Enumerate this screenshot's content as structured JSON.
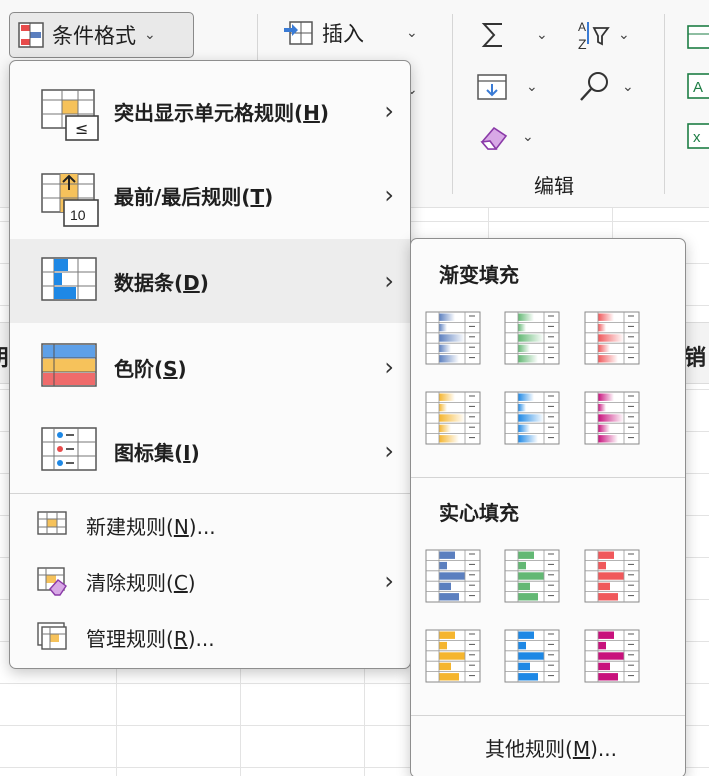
{
  "ribbon": {
    "conditional_format_label": "条件格式",
    "insert_label": "插入",
    "edit_group_label": "编辑"
  },
  "sheet": {
    "left_col_fragment": "刖",
    "right_col_fragment": "销"
  },
  "menu": {
    "items": [
      {
        "label_prefix": "突出显示单元格规则(",
        "mnemonic": "H",
        "label_suffix": ")",
        "icon": "highlight-cells-rules-icon"
      },
      {
        "label_prefix": "最前/最后规则(",
        "mnemonic": "T",
        "label_suffix": ")",
        "icon": "top-bottom-rules-icon"
      },
      {
        "label_prefix": "数据条(",
        "mnemonic": "D",
        "label_suffix": ")",
        "icon": "data-bars-icon"
      },
      {
        "label_prefix": "色阶(",
        "mnemonic": "S",
        "label_suffix": ")",
        "icon": "color-scales-icon"
      },
      {
        "label_prefix": "图标集(",
        "mnemonic": "I",
        "label_suffix": ")",
        "icon": "icon-sets-icon"
      }
    ],
    "small_items": [
      {
        "label_prefix": "新建规则(",
        "mnemonic": "N",
        "label_suffix": ")...",
        "icon": "new-rule-icon"
      },
      {
        "label_prefix": "清除规则(",
        "mnemonic": "C",
        "label_suffix": ")",
        "icon": "clear-rules-icon"
      },
      {
        "label_prefix": "管理规则(",
        "mnemonic": "R",
        "label_suffix": ")...",
        "icon": "manage-rules-icon"
      }
    ]
  },
  "submenu": {
    "gradient_title": "渐变填充",
    "solid_title": "实心填充",
    "more_prefix": "其他规则(",
    "more_mnemonic": "M",
    "more_suffix": ")...",
    "colors": [
      "#5b7fbf",
      "#63b874",
      "#f0585b",
      "#f5b52e",
      "#1e88e5",
      "#c8117c"
    ]
  }
}
